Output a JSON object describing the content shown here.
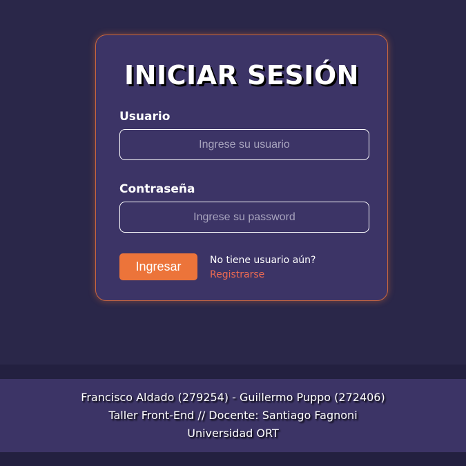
{
  "login": {
    "title": "INICIAR SESIÓN",
    "username_label": "Usuario",
    "username_placeholder": "Ingrese su usuario",
    "password_label": "Contraseña",
    "password_placeholder": "Ingrese su password",
    "submit_label": "Ingresar",
    "register_prompt": "No tiene usuario aún?",
    "register_link": "Registrarse"
  },
  "footer": {
    "authors": "Francisco Aldado (279254) - Guillermo Puppo (272406)",
    "course": "Taller Front-End // Docente: Santiago Fagnoni",
    "university": "Universidad ORT"
  },
  "colors": {
    "background": "#2a2749",
    "card": "#3c3466",
    "accent": "#ec743a",
    "link": "#ef6b52"
  }
}
